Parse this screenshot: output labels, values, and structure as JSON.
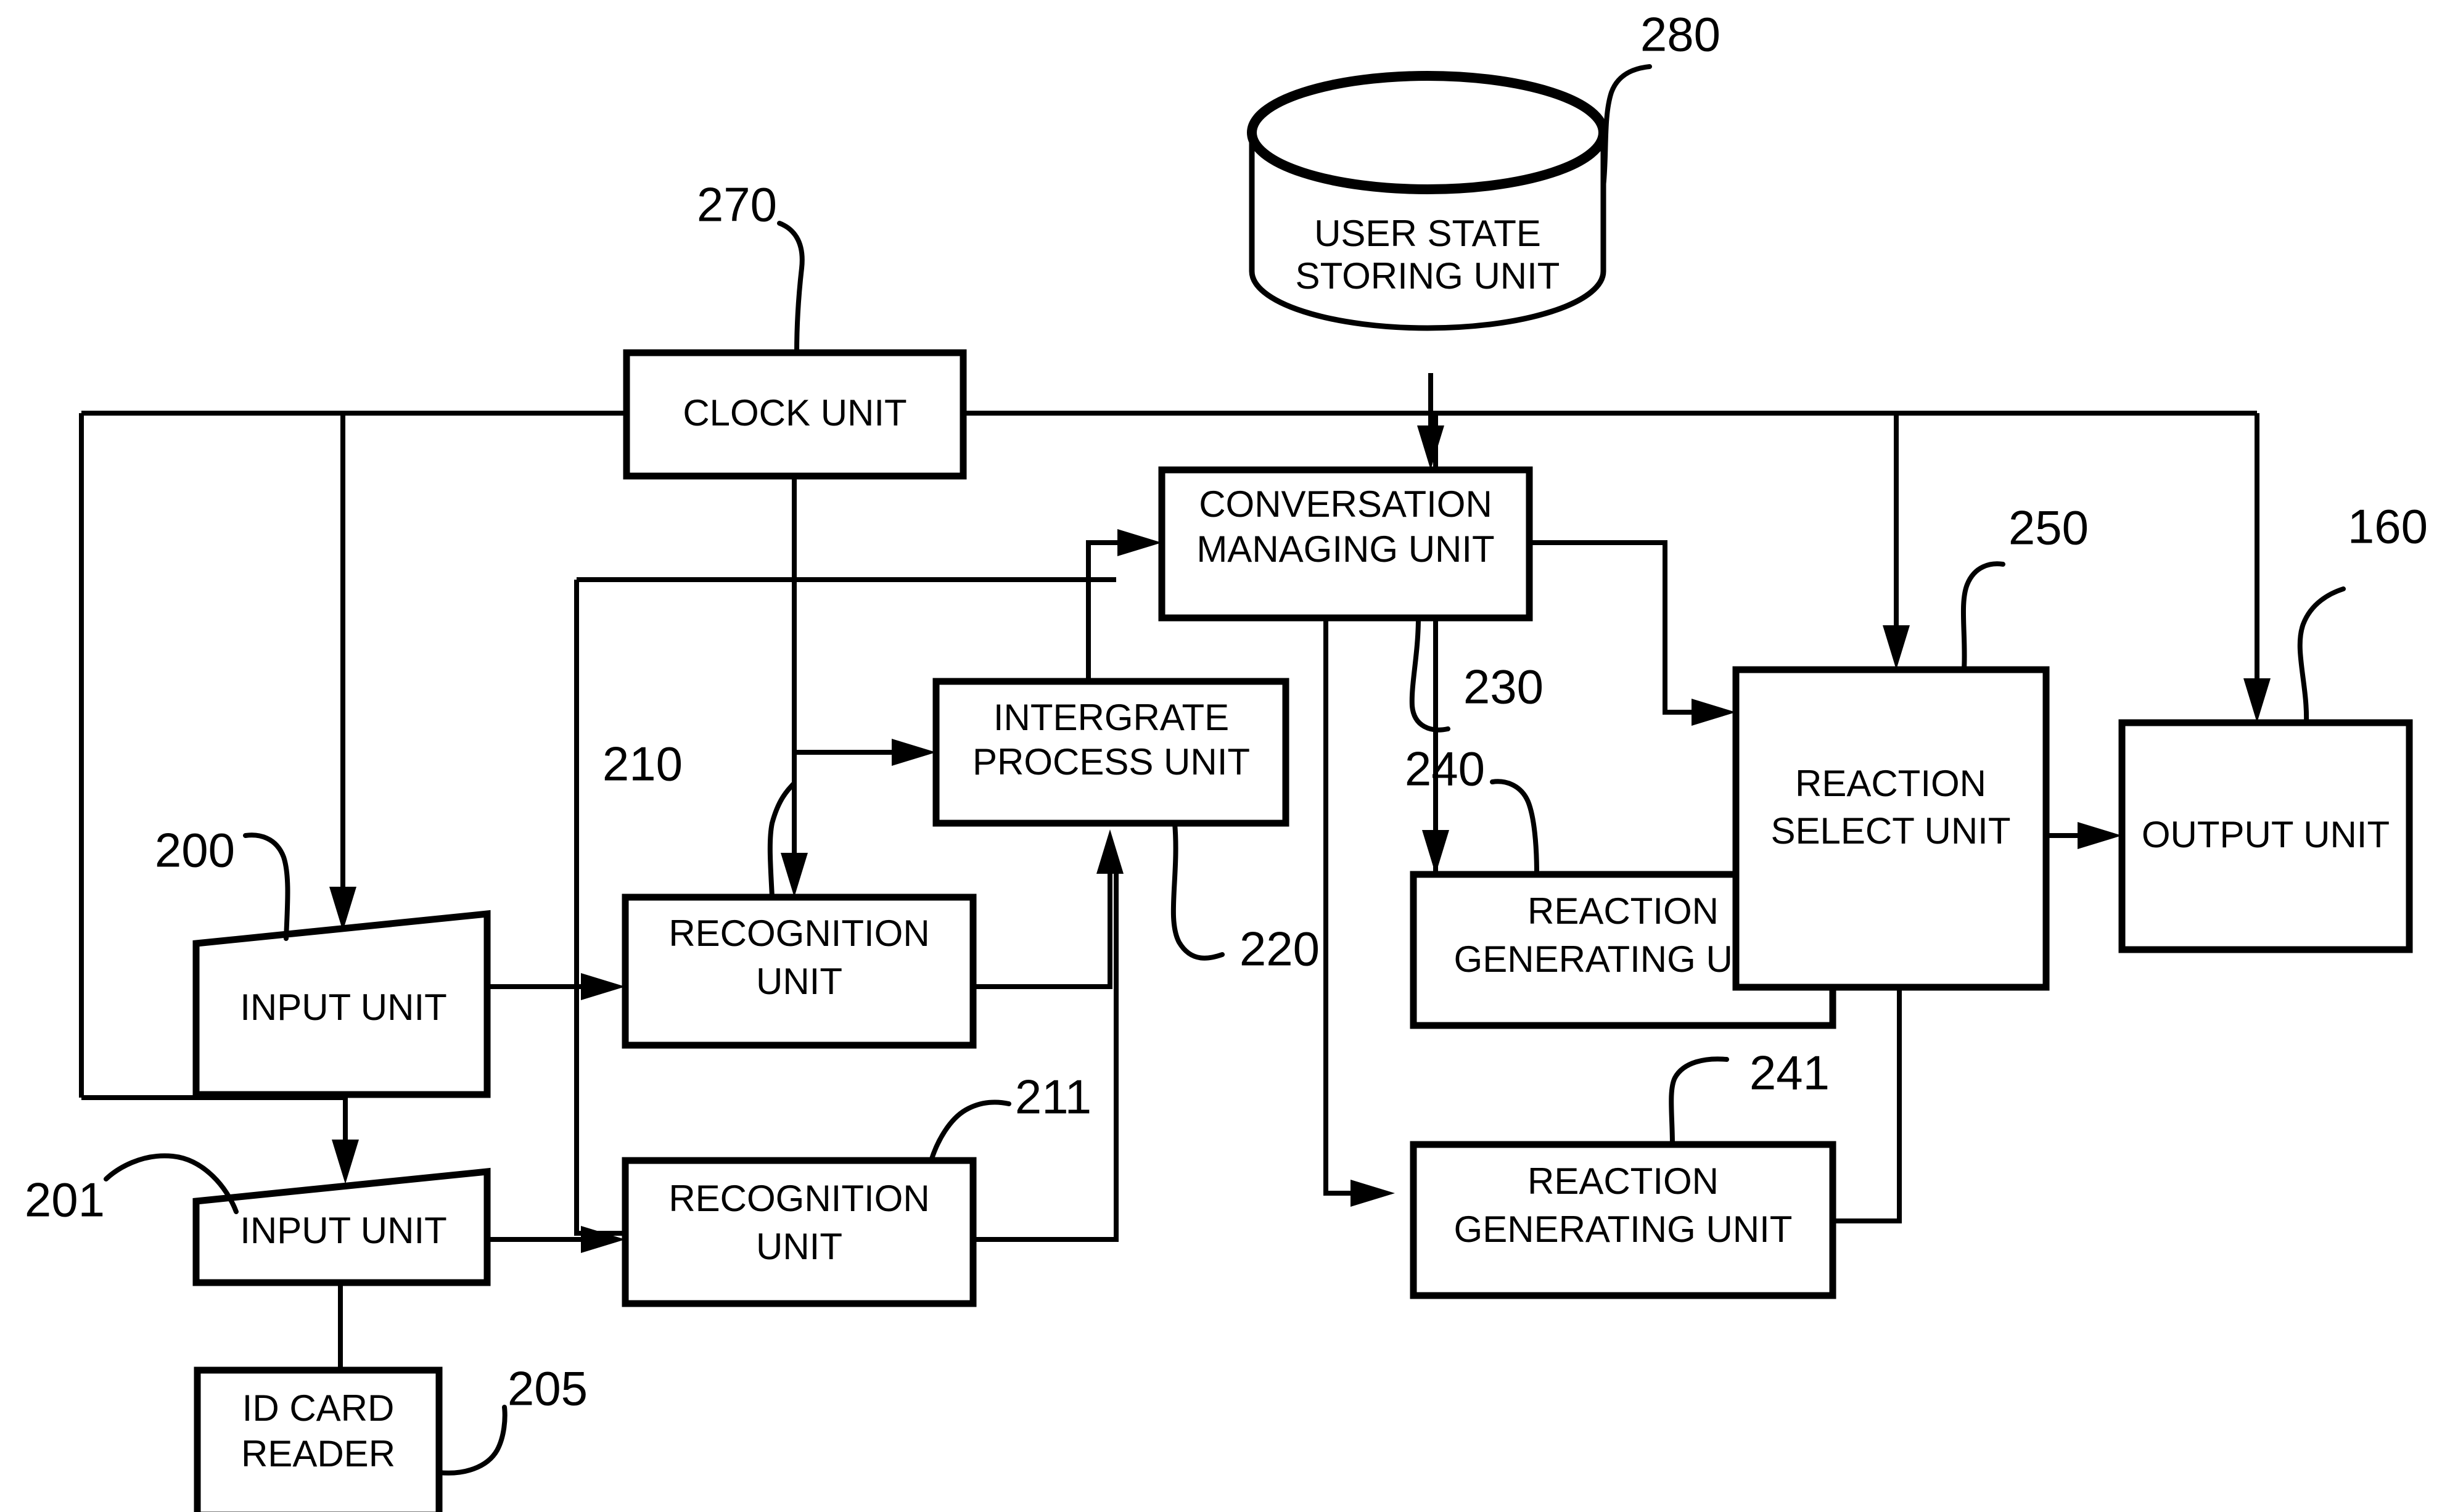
{
  "figure": {
    "kind": "patent-block-diagram",
    "background_color": "#ffffff",
    "line_color": "#000000"
  },
  "blocks": {
    "clock_unit": {
      "label": "CLOCK UNIT",
      "ref": "270"
    },
    "user_state_storing_unit": {
      "label_line1": "USER STATE",
      "label_line2": "STORING UNIT",
      "ref": "280"
    },
    "conversation_managing_unit": {
      "label_line1": "CONVERSATION",
      "label_line2": "MANAGING UNIT",
      "ref": "230"
    },
    "intergrate_process_unit": {
      "label_line1": "INTERGRATE",
      "label_line2": "PROCESS UNIT",
      "ref": "220"
    },
    "input_unit_200": {
      "label": "INPUT UNIT",
      "ref": "200"
    },
    "input_unit_201": {
      "label": "INPUT UNIT",
      "ref": "201"
    },
    "recognition_unit_210": {
      "label_line1": "RECOGNITION",
      "label_line2": "UNIT",
      "ref": "210"
    },
    "recognition_unit_211": {
      "label_line1": "RECOGNITION",
      "label_line2": "UNIT",
      "ref": "211"
    },
    "id_card_reader": {
      "label_line1": "ID CARD",
      "label_line2": "READER",
      "ref": "205"
    },
    "reaction_generating_unit_240": {
      "label_line1": "REACTION",
      "label_line2": "GENERATING UNIT",
      "ref": "240"
    },
    "reaction_generating_unit_241": {
      "label_line1": "REACTION",
      "label_line2": "GENERATING UNIT",
      "ref": "241"
    },
    "reaction_select_unit": {
      "label_line1": "REACTION",
      "label_line2": "SELECT UNIT",
      "ref": "250"
    },
    "output_unit": {
      "label": "OUTPUT UNIT",
      "ref": "160"
    }
  },
  "reference_numerals": [
    "280",
    "270",
    "250",
    "160",
    "230",
    "210",
    "200",
    "220",
    "240",
    "211",
    "241",
    "201",
    "205"
  ]
}
